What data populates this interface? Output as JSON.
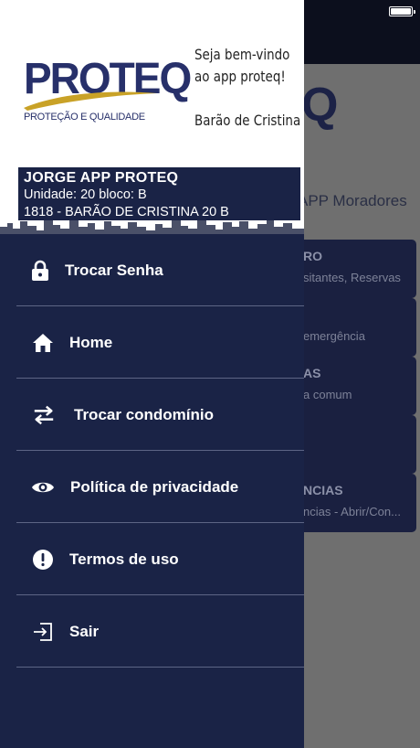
{
  "background_app": {
    "logo_fragment": "Q",
    "app_title": "APP Moradores",
    "cards": [
      {
        "title": "RO",
        "subtitle": "sitantes, Reservas"
      },
      {
        "title": "",
        "subtitle": "emergência"
      },
      {
        "title": "AS",
        "subtitle": "a comum"
      },
      {
        "title": "",
        "subtitle": ""
      },
      {
        "title": "NCIAS",
        "subtitle": "ncias - Abrir/Con..."
      }
    ]
  },
  "header": {
    "logo": {
      "word": "PROTEQ",
      "tagline": "PROTEÇÃO E QUALIDADE"
    },
    "welcome_line1": "Seja bem-vindo",
    "welcome_line2": "ao app proteq!",
    "condo_name": "Barão de Cristina"
  },
  "user": {
    "name": "JORGE APP PROTEQ",
    "unit": "Unidade: 20 bloco: B",
    "condo": "1818 - BARÃO DE CRISTINA 20 B"
  },
  "menu": [
    {
      "label": "Trocar Senha",
      "icon": "lock-icon"
    },
    {
      "label": "Home",
      "icon": "home-icon"
    },
    {
      "label": "Trocar condomínio",
      "icon": "swap-arrows-icon"
    },
    {
      "label": "Política de privacidade",
      "icon": "eye-icon"
    },
    {
      "label": "Termos de uso",
      "icon": "alert-circle-icon"
    },
    {
      "label": "Sair",
      "icon": "logout-icon"
    }
  ],
  "colors": {
    "drawer_bg": "#1a2346",
    "header_bg": "#ffffff",
    "brand": "#27306a",
    "accent_gold": "#c9a227"
  }
}
